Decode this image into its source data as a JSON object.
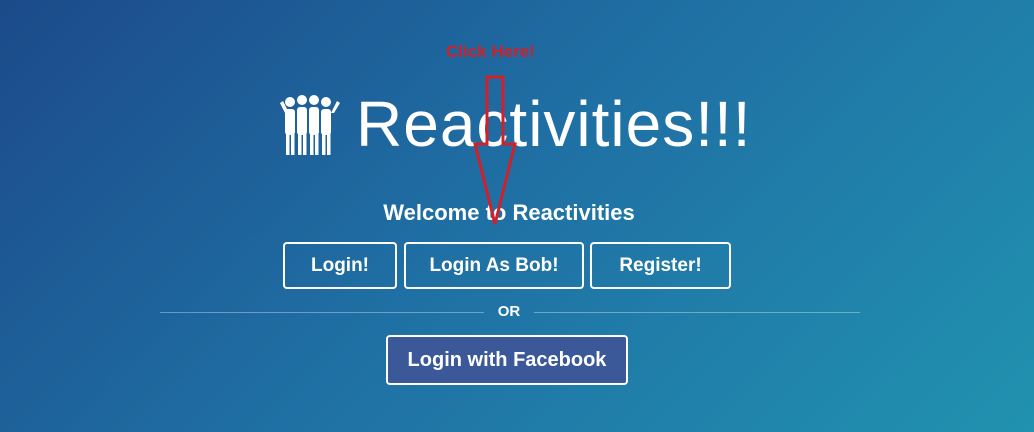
{
  "annotation": {
    "text": "Click Here!",
    "color": "#d0202a"
  },
  "header": {
    "logo_icon": "people-group-icon",
    "title": "Reactivities!!!"
  },
  "welcome": "Welcome to Reactivities",
  "buttons": {
    "login": "Login!",
    "login_as_bob": "Login As Bob!",
    "register": "Register!"
  },
  "divider": {
    "text": "OR"
  },
  "facebook": {
    "label": "Login with Facebook",
    "color": "#3b5998"
  },
  "colors": {
    "gradient_start": "#1c4a8a",
    "gradient_end": "#2192b0"
  }
}
